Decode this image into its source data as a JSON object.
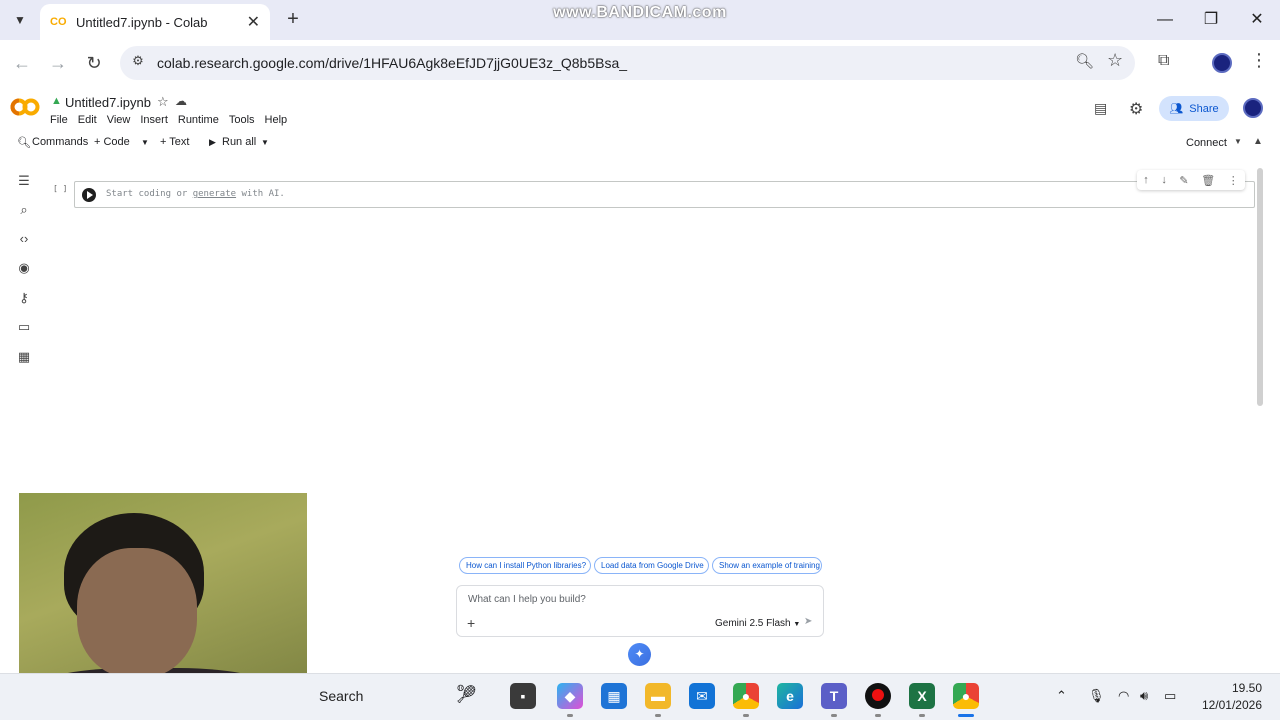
{
  "browser": {
    "tab_title": "Untitled7.ipynb - Colab",
    "url": "colab.research.google.com/drive/1HFAU6Agk8eEfJD7jjG0UE3z_Q8b5Bsa_",
    "watermark": "www.BANDICAM.com",
    "new_tab_label": "+",
    "minimize_label": "—",
    "restore_label": "❐",
    "close_label": "✕"
  },
  "colab": {
    "notebook_title": "Untitled7.ipynb",
    "menu": [
      "File",
      "Edit",
      "View",
      "Insert",
      "Runtime",
      "Tools",
      "Help"
    ],
    "share_label": "Share",
    "toolbar": {
      "commands": "Commands",
      "code": "+ Code",
      "text": "+ Text",
      "run_all": "Run all"
    },
    "connect_label": "Connect",
    "cell": {
      "bracket": "[ ]",
      "placeholder_pre": "Start coding or ",
      "placeholder_link": "generate",
      "placeholder_post": " with AI."
    }
  },
  "gemini": {
    "chips": [
      "How can I install Python libraries?",
      "Load data from Google Drive",
      "Show an example of training a"
    ],
    "placeholder": "What can I help you build?",
    "model": "Gemini 2.5 Flash"
  },
  "taskbar": {
    "search_label": "Search",
    "time": "19.50",
    "date": "12/01/2026"
  },
  "colors": {
    "accent": "#0b57d0",
    "share_bg": "#d3e3fd",
    "colab_orange": "#f9ab00"
  }
}
